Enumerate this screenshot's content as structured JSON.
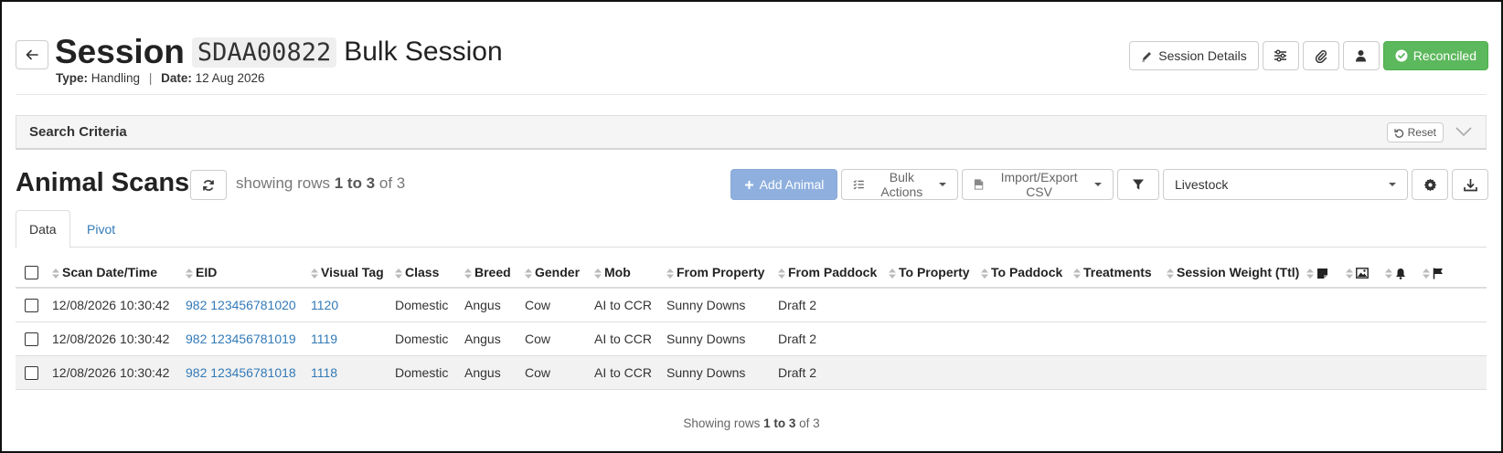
{
  "header": {
    "title_word": "Session",
    "session_code": "SDAA00822",
    "session_kind": "Bulk Session",
    "type_label": "Type:",
    "type_value": "Handling",
    "separator": "|",
    "date_label": "Date:",
    "date_value": "12 Aug 2026"
  },
  "top_actions": {
    "session_details": "Session Details",
    "reconciled": "Reconciled",
    "reconciled_color": "#5cb85c"
  },
  "search": {
    "label": "Search Criteria",
    "reset": "Reset"
  },
  "scans": {
    "title": "Animal Scans",
    "showing_prefix": "showing rows",
    "showing_range": "1 to 3",
    "showing_suffix": "of 3",
    "add_animal": "Add Animal",
    "add_animal_color": "#8fb0de",
    "bulk_actions": "Bulk Actions",
    "import_export": "Import/Export CSV",
    "select_value": "Livestock"
  },
  "tabs": [
    {
      "label": "Data",
      "active": true
    },
    {
      "label": "Pivot",
      "active": false
    }
  ],
  "table": {
    "columns": [
      "Scan Date/Time",
      "EID",
      "Visual Tag",
      "Class",
      "Breed",
      "Gender",
      "Mob",
      "From Property",
      "From Paddock",
      "To Property",
      "To Paddock",
      "Treatments",
      "Session Weight (Ttl)"
    ],
    "icon_columns": [
      "note-icon",
      "image-icon",
      "bell-icon",
      "flag-icon"
    ],
    "rows": [
      {
        "datetime": "12/08/2026 10:30:42",
        "eid": "982 123456781020",
        "visual_tag": "1120",
        "class": "Domestic",
        "breed": "Angus",
        "gender": "Cow",
        "mob": "AI to CCR",
        "from_property": "Sunny Downs",
        "from_paddock": "Draft 2"
      },
      {
        "datetime": "12/08/2026 10:30:42",
        "eid": "982 123456781019",
        "visual_tag": "1119",
        "class": "Domestic",
        "breed": "Angus",
        "gender": "Cow",
        "mob": "AI to CCR",
        "from_property": "Sunny Downs",
        "from_paddock": "Draft 2"
      },
      {
        "datetime": "12/08/2026 10:30:42",
        "eid": "982 123456781018",
        "visual_tag": "1118",
        "class": "Domestic",
        "breed": "Angus",
        "gender": "Cow",
        "mob": "AI to CCR",
        "from_property": "Sunny Downs",
        "from_paddock": "Draft 2"
      }
    ]
  },
  "footer": {
    "prefix": "Showing rows",
    "range": "1 to 3",
    "suffix": "of 3"
  }
}
